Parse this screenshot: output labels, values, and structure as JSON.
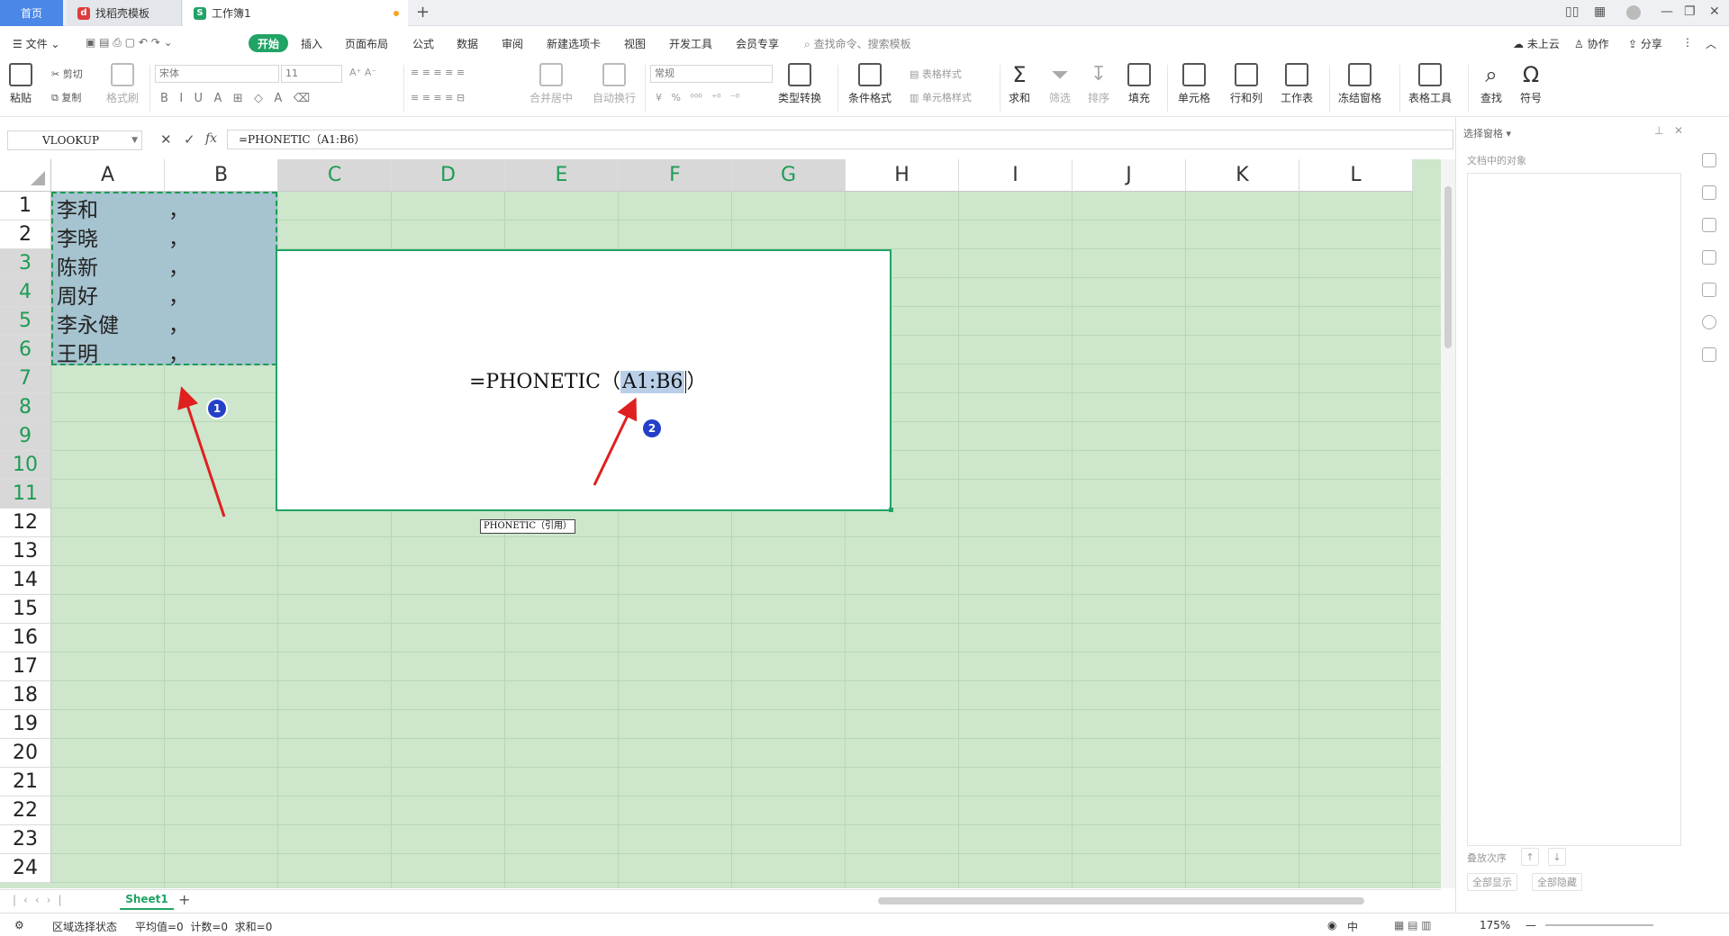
{
  "titlebar": {
    "tabs": [
      {
        "label": "首页"
      },
      {
        "label": "找稻壳模板"
      },
      {
        "label": "工作簿1"
      }
    ],
    "new_tab": "+"
  },
  "menubar": {
    "file": "文件",
    "start": "开始",
    "items": [
      "插入",
      "页面布局",
      "公式",
      "数据",
      "审阅",
      "新建选项卡",
      "视图",
      "开发工具",
      "会员专享"
    ],
    "search_placeholder": "查找命令、搜索模板",
    "cloud": "未上云",
    "collab": "协作",
    "share": "分享"
  },
  "ribbon": {
    "paste": "粘贴",
    "cut": "剪切",
    "copy": "复制",
    "format_painter": "格式刷",
    "font_name": "宋体",
    "font_size": "11",
    "merge_center": "合并居中",
    "wrap": "自动换行",
    "number_format": "常规",
    "type_convert": "类型转换",
    "conditional_format": "条件格式",
    "table_style": "表格样式",
    "cell_style": "单元格样式",
    "sum": "求和",
    "filter": "筛选",
    "sort": "排序",
    "fill": "填充",
    "cell": "单元格",
    "row_col": "行和列",
    "worksheet": "工作表",
    "freeze": "冻结窗格",
    "table_tools": "表格工具",
    "find": "查找",
    "symbol": "符号"
  },
  "formulabar": {
    "name_box": "VLOOKUP",
    "fx": "fx",
    "formula": "=PHONETIC（A1:B6）"
  },
  "sheet": {
    "columns": [
      "A",
      "B",
      "C",
      "D",
      "E",
      "F",
      "G",
      "H",
      "I",
      "J",
      "K",
      "L"
    ],
    "rows": [
      "1",
      "2",
      "3",
      "4",
      "5",
      "6",
      "7",
      "8",
      "9",
      "10",
      "11",
      "12",
      "13",
      "14",
      "15",
      "16",
      "17",
      "18",
      "19",
      "20",
      "21",
      "22",
      "23",
      "24"
    ],
    "col_a": [
      "李和",
      "李晓",
      "陈新",
      "周好",
      "李永健",
      "王明"
    ],
    "col_b": [
      "，",
      "，",
      "，",
      "，",
      "，",
      "，"
    ],
    "edit_prefix": "=PHONETIC（",
    "edit_ref": "A1:B6",
    "edit_suffix": "）",
    "tooltip": "PHONETIC（引用）",
    "badge1": "1",
    "badge2": "2",
    "annotation_color": "#e02020",
    "accent": "#21a366"
  },
  "rightpane": {
    "title": "选择窗格",
    "subtitle": "文档中的对象",
    "order_label": "叠放次序",
    "show_all": "全部显示",
    "hide_all": "全部隐藏"
  },
  "sheetbar": {
    "sheet_name": "Sheet1",
    "add": "+"
  },
  "statusbar": {
    "mode": "区域选择状态",
    "stats": "平均值=0  计数=0  求和=0",
    "zoom": "175%",
    "lang": "中"
  }
}
